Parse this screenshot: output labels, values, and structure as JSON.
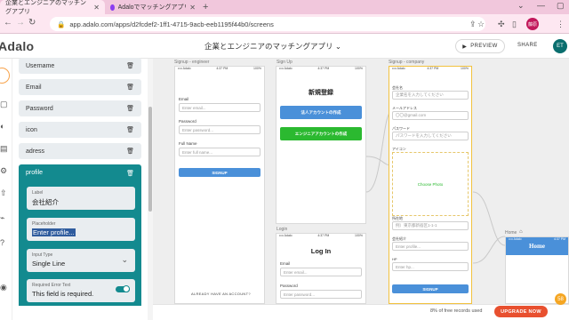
{
  "browser": {
    "tabs": [
      {
        "title": "企業とエンジニアのマッチングアプリ",
        "active": true
      },
      {
        "title": "Adaloでマッチングアプリを作ってみ",
        "active": false
      }
    ],
    "url": "app.adalo.com/apps/d2fcdef2-1ff1-4715-9acb-eeb1195f44b0/screens",
    "profile_initials": "藤原"
  },
  "header": {
    "logo": "Adalo",
    "app_title": "企業とエンジニアのマッチングアプリ",
    "preview_label": "PREVIEW",
    "share_label": "SHARE",
    "user_initials": "ET"
  },
  "panel": {
    "properties": [
      {
        "label": "Username"
      },
      {
        "label": "Email"
      },
      {
        "label": "Password"
      },
      {
        "label": "icon"
      },
      {
        "label": "adress"
      }
    ],
    "selected": {
      "name": "profile",
      "label_field": {
        "caption": "Label",
        "value": "会社紹介"
      },
      "placeholder_field": {
        "caption": "Placeholder",
        "value": "Enter profile..."
      },
      "input_type": {
        "caption": "Input Type",
        "value": "Single Line"
      },
      "required_error": {
        "caption": "Required Error Text",
        "value": "This field is required.",
        "enabled": true
      }
    }
  },
  "canvas": {
    "signup_engineer": {
      "label": "Signup - engineer",
      "status_time": "4:37 PM",
      "email_label": "Email",
      "email_placeholder": "Enter email...",
      "password_label": "Password",
      "password_placeholder": "Enter password...",
      "fullname_label": "Full Name",
      "fullname_placeholder": "Enter full name...",
      "signup_button": "SIGNUP",
      "login_link": "ALREADY HAVE AN ACCOUNT?"
    },
    "signup": {
      "label": "Sign Up",
      "status_time": "4:37 PM",
      "title": "新規登録",
      "company_button": "法人アカウントの作成",
      "engineer_button": "エンジニアアカウントの作成",
      "company_color": "#4a90d9",
      "engineer_color": "#2bb930"
    },
    "login": {
      "label": "Login",
      "status_time": "4:37 PM",
      "title": "Log In",
      "email_label": "Email",
      "email_placeholder": "Enter email...",
      "password_label": "Password",
      "password_placeholder": "Enter password..."
    },
    "signup_company": {
      "label": "Signup - company",
      "status_time": "4:37 PM",
      "f1_label": "会社名",
      "f1_placeholder": "企業名を入力してください",
      "f2_label": "メールアドレス",
      "f2_placeholder": "〇〇@gmail.com",
      "f3_label": "パスワード",
      "f3_placeholder": "パスワードを入力してください",
      "f4_label": "アイコン",
      "image_picker": "Choose Photo",
      "f5_label": "所在地",
      "f5_placeholder": "例）東京都新宿区1-1-1",
      "f6_label": "会社紹介",
      "f6_placeholder": "Enter profile...",
      "f7_label": "HP",
      "f7_placeholder": "Enter hp...",
      "signup_button": "SIGNUP"
    },
    "home": {
      "label": "Home",
      "status_time": "4:37 PM",
      "title": "Home",
      "header_color": "#4a90d9"
    }
  },
  "footer": {
    "records": "8% of free records used",
    "upgrade_label": "UPGRADE NOW",
    "help_badge": "58"
  }
}
